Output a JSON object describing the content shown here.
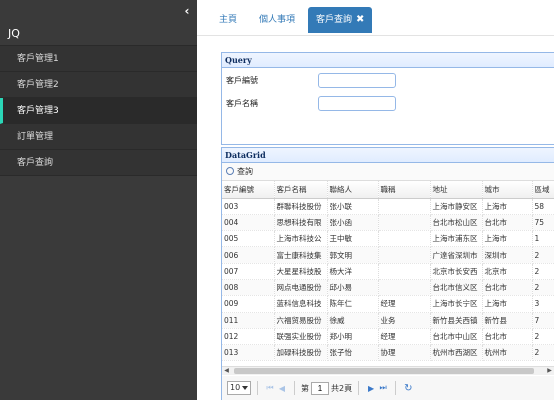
{
  "sidebar": {
    "title": "JQ",
    "collapse_glyph": "‹",
    "items": [
      {
        "label": "客戶管理1",
        "active": false
      },
      {
        "label": "客戶管理2",
        "active": false
      },
      {
        "label": "客戶管理3",
        "active": true
      },
      {
        "label": "訂單管理",
        "active": false
      },
      {
        "label": "客戶查詢",
        "active": false
      }
    ],
    "accent_color": "#2bd6b7"
  },
  "tabs": {
    "items": [
      {
        "label": "主頁"
      },
      {
        "label": "個人事項"
      },
      {
        "label": "客戶查詢",
        "active": true,
        "close": "✖"
      }
    ],
    "active_color": "#337ab7"
  },
  "query": {
    "title": "Query",
    "fields": [
      {
        "label": "客戶編號",
        "value": ""
      },
      {
        "label": "客戶名稱",
        "value": ""
      }
    ]
  },
  "grid": {
    "title": "DataGrid",
    "toolbar_search": "查詢",
    "columns": [
      "客戶編號",
      "客戶名稱",
      "聯絡人",
      "職稱",
      "地址",
      "城市",
      "區域"
    ],
    "rows": [
      [
        "003",
        "群聯科技股份",
        "张小联",
        "",
        "上海市静安区",
        "上海市",
        "58"
      ],
      [
        "004",
        "思想科技有限",
        "张小函",
        "",
        "台北市松山区",
        "台北市",
        "75"
      ],
      [
        "005",
        "上海市科技公",
        "王中敏",
        "",
        "上海市浦东区",
        "上海市",
        "1"
      ],
      [
        "006",
        "富士康科技集",
        "郭文明",
        "",
        "广達省深圳市",
        "深圳市",
        "2"
      ],
      [
        "007",
        "大星星科技股",
        "杨大洋",
        "",
        "北京市长安西",
        "北京市",
        "2"
      ],
      [
        "008",
        "网点电通股份",
        "邱小易",
        "",
        "台北市信义区",
        "台北市",
        "2"
      ],
      [
        "009",
        "蓝科信息科技",
        "陈年仁",
        "经理",
        "上海市长宁区",
        "上海市",
        "3"
      ],
      [
        "011",
        "六福贸易股份",
        "徐威",
        "业务",
        "新竹县关西镇",
        "新竹县",
        "7"
      ],
      [
        "012",
        "联强实业股份",
        "郑小明",
        "经理",
        "台北市中山区",
        "台北市",
        "2"
      ],
      [
        "013",
        "加碌科技股份",
        "张子怡",
        "协理",
        "杭州市西湖区",
        "杭州市",
        "2"
      ]
    ]
  },
  "pager": {
    "page_size": "10",
    "page_prefix": "第",
    "page_value": "1",
    "page_suffix": "共2頁"
  }
}
